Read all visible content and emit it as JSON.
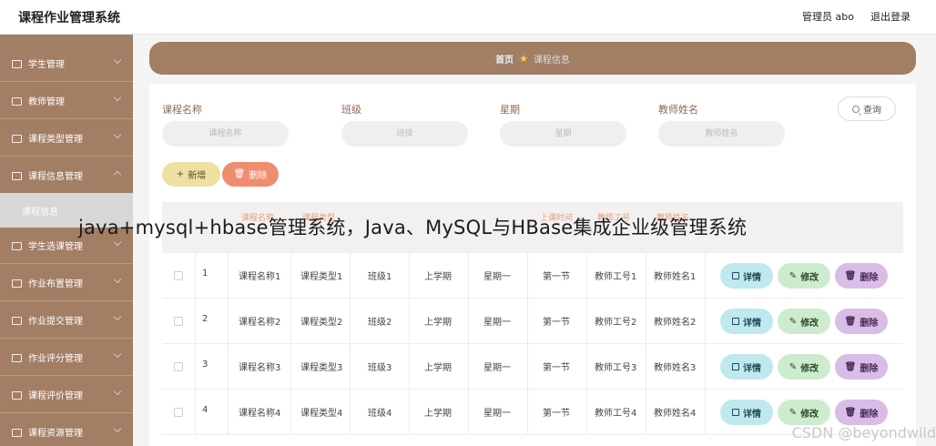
{
  "app": {
    "title": "课程作业管理系统"
  },
  "header": {
    "user_label": "管理员 abo",
    "logout_label": "退出登录"
  },
  "sidebar": {
    "items": [
      {
        "label": "学生管理",
        "icon": "user-icon"
      },
      {
        "label": "教师管理",
        "icon": "teacher-icon"
      },
      {
        "label": "课程类型管理",
        "icon": "list-icon"
      },
      {
        "label": "课程信息管理",
        "icon": "info-icon"
      },
      {
        "label": "学生选课管理",
        "icon": "chart-icon"
      },
      {
        "label": "作业布置管理",
        "icon": "clock-icon"
      },
      {
        "label": "作业提交管理",
        "icon": "play-icon"
      },
      {
        "label": "作业评分管理",
        "icon": "flag-icon"
      },
      {
        "label": "课程评价管理",
        "icon": "doc-icon"
      },
      {
        "label": "课程资源管理",
        "icon": "folder-icon"
      }
    ],
    "active_sub": "课程信息"
  },
  "breadcrumb": {
    "home": "首页",
    "current": "课程信息"
  },
  "filters": [
    {
      "label": "课程名称",
      "placeholder": "课程名称"
    },
    {
      "label": "班级",
      "placeholder": "班级"
    },
    {
      "label": "星期",
      "placeholder": "星期"
    },
    {
      "label": "教师姓名",
      "placeholder": "教师姓名"
    }
  ],
  "actions": {
    "query": "查询",
    "add": "新增",
    "delete": "删除"
  },
  "table": {
    "headers": [
      "课程名称",
      "课程类型",
      "上课时间",
      "教师工号",
      "教师姓名"
    ],
    "rows": [
      [
        "1",
        "课程名称1",
        "课程类型1",
        "班级1",
        "上学期",
        "星期一",
        "第一节",
        "教师工号1",
        "教师姓名1"
      ],
      [
        "2",
        "课程名称2",
        "课程类型2",
        "班级2",
        "上学期",
        "星期一",
        "第一节",
        "教师工号2",
        "教师姓名2"
      ],
      [
        "3",
        "课程名称3",
        "课程类型3",
        "班级3",
        "上学期",
        "星期一",
        "第一节",
        "教师工号3",
        "教师姓名3"
      ],
      [
        "4",
        "课程名称4",
        "课程类型4",
        "班级4",
        "上学期",
        "星期一",
        "第一节",
        "教师工号4",
        "教师姓名4"
      ]
    ],
    "row_actions": {
      "detail": "详情",
      "edit": "修改",
      "delete": "删除"
    }
  },
  "overlay": {
    "caption": "java+mysql+hbase管理系统，Java、MySQL与HBase集成企业级管理系统",
    "csdn": "CSDN @beyondwild"
  }
}
